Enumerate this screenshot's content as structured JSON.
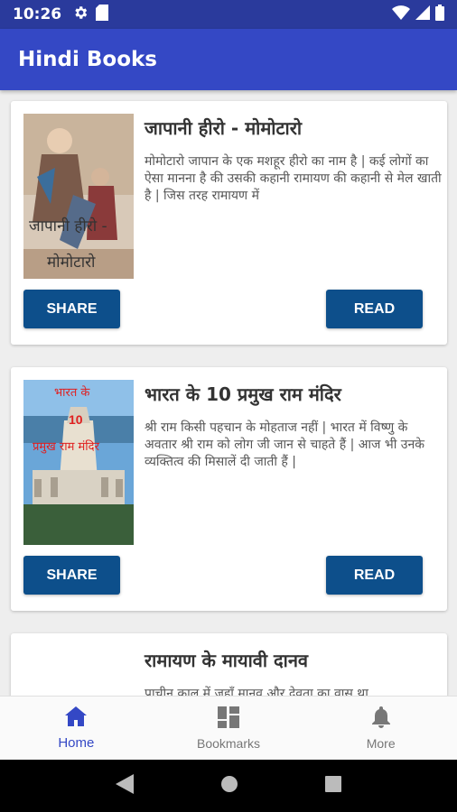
{
  "status": {
    "time": "10:26"
  },
  "app": {
    "title": "Hindi Books"
  },
  "books": [
    {
      "title": "जापानी हीरो - मोमोटारो",
      "description": "मोमोटारो जापान के एक मशहूर हीरो का नाम है | कई लोगों का ऐसा मानना है की उसकी कहानी रामायण की कहानी से मेल खाती है | जिस तरह रामायण में",
      "cover_lines": [
        "जापानी हीरो -",
        "मोमोटारो"
      ],
      "share_label": "SHARE",
      "read_label": "READ"
    },
    {
      "title": "भारत के 10 प्रमुख राम मंदिर",
      "description": "श्री राम किसी पहचान के मोहताज नहीं | भारत में विष्णु के अवतार श्री राम को लोग जी जान से चाहते हैं | आज भी उनके व्यक्तित्व की मिसालें दी जाती हैं |",
      "cover_lines": [
        "भारत के",
        "10",
        "प्रमुख राम मंदिर"
      ],
      "share_label": "SHARE",
      "read_label": "READ"
    },
    {
      "title": "रामायण के मायावी दानव",
      "description": "प्राचीन काल में जहाँ मानव और देवता का वास था"
    }
  ],
  "bottom_nav": {
    "home": "Home",
    "bookmarks": "Bookmarks",
    "more": "More"
  },
  "colors": {
    "status_bar": "#2a3a9c",
    "app_bar": "#3448c5",
    "button": "#0d4f8b",
    "active_nav": "#3448c5"
  }
}
